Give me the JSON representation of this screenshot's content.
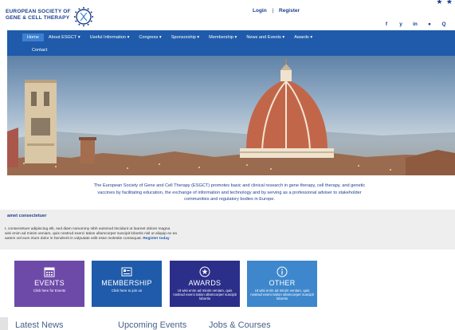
{
  "corner_stars": "★ ★",
  "header": {
    "logo_line1": "EUROPEAN SOCIETY OF",
    "logo_line2": "GENE & CELL THERAPY",
    "login": "Login",
    "separator": "|",
    "register": "Register",
    "socials": [
      "f",
      "y",
      "in",
      "●",
      "Q"
    ]
  },
  "nav": {
    "items": [
      "Home",
      "About ESGCT ▾",
      "Useful Information ▾",
      "Congress ▾",
      "Sponsorship ▾",
      "Membership ▾",
      "News and Events ▾",
      "Awards ▾"
    ],
    "contact": "Contact"
  },
  "intro": {
    "line1": "The European Society of Gene and Cell Therapy (ESGCT) promotes basic and clinical research in gene therapy, cell therapy, and genetic",
    "line2": "vaccines by facilitating education, the exchange of information and technology and by serving as a professional adviser to stakeholder",
    "line3": "communities and regulatory bodies in Europe."
  },
  "band": {
    "title": "amet consectetuer",
    "line1": "t, consectetuer adipiscing elit, sed diam nonummy nibh euismod tincidunt ut laoreet dolore magna",
    "line2": "wisi enim ad minim veniam, quis nostrud exerci tation ullamcorper suscipit lobortis nisl ut aliquip ex ea",
    "line3": "autem vel eum iriure dolor in hendrerit in vulputate velit esse molestie consequat.",
    "register_link": "Register today"
  },
  "tiles": [
    {
      "title": "EVENTS",
      "sub": "Click here for Events",
      "color": "#6e4aa8"
    },
    {
      "title": "MEMBERSHIP",
      "sub": "Click here to join us",
      "color": "#1f5baa"
    },
    {
      "title": "AWARDS",
      "sub": "Ut wisi enim ad minim veniam, quis nostrud exerci tation ullamcorper suscipit lobortis",
      "color": "#2b2f8a"
    },
    {
      "title": "OTHER",
      "sub": "Ut wisi enim ad minim veniam, quis nostrud exerci tation ullamcorper suscipit lobortis",
      "color": "#3e87cc"
    }
  ],
  "sections": {
    "latest_news": "Latest News",
    "upcoming_events": "Upcoming Events",
    "jobs_courses": "Jobs & Courses"
  }
}
